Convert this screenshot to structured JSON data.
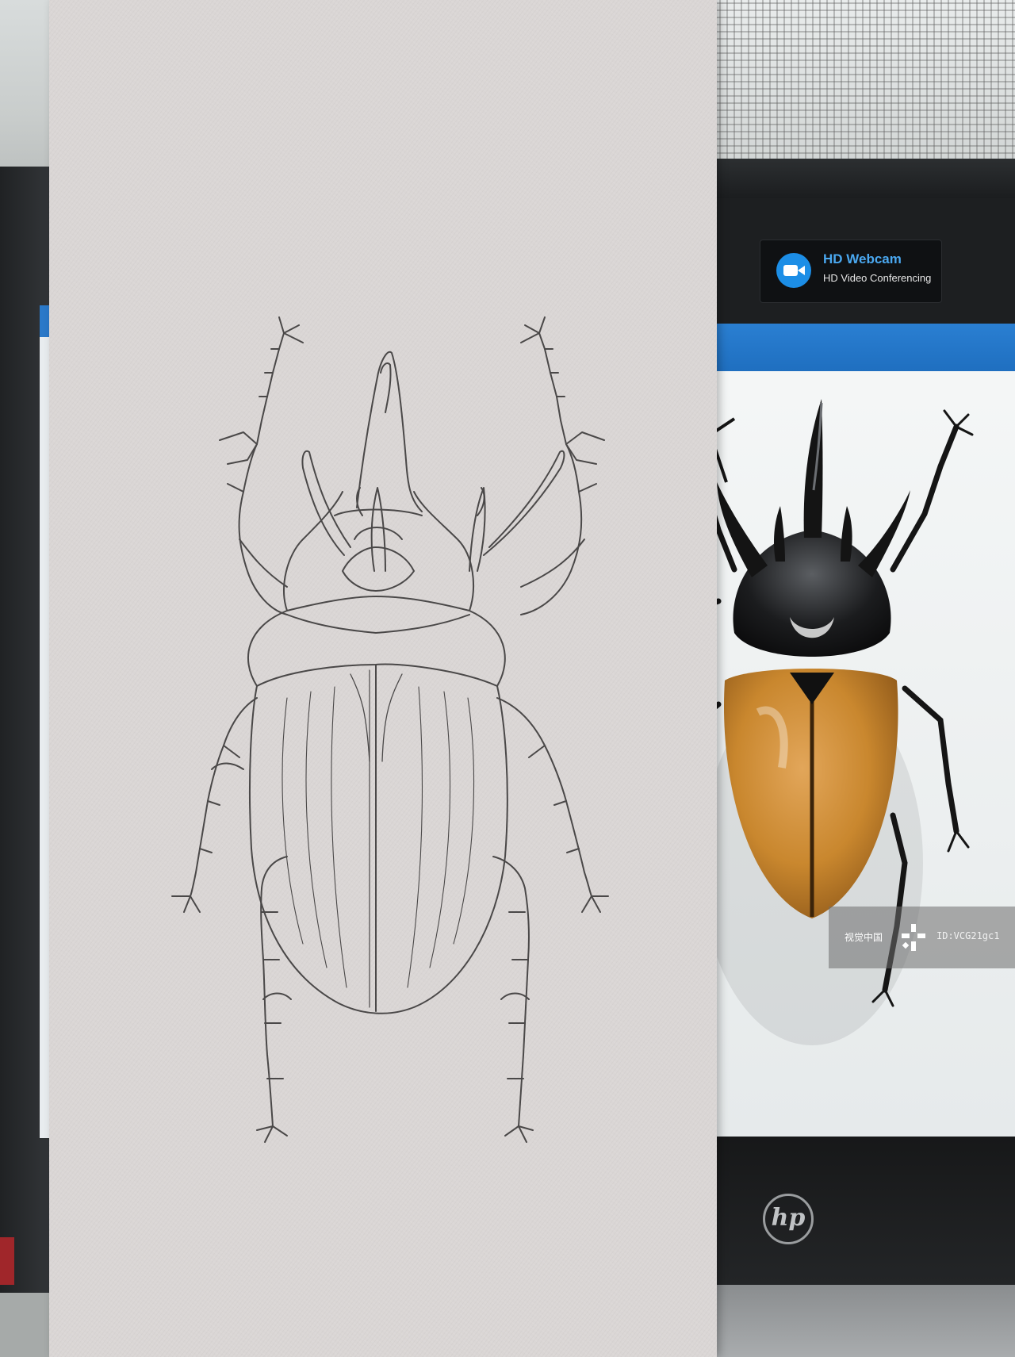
{
  "scene": {
    "subject": "beetle-sketch",
    "paper_color": "#dad6d5",
    "pencil_color": "#4a4848",
    "beetle_elytra_color": "#c9872e",
    "screen_bar_color": "#2a7fd2"
  },
  "webcam_badge": {
    "title": "HD Webcam",
    "subtitle": "HD Video Conferencing",
    "icon": "camera-icon",
    "icon_label": "HD"
  },
  "watermark": {
    "brand": "视觉中国",
    "id": "ID:VCG21gc1"
  },
  "laptop": {
    "logo": "hp"
  }
}
